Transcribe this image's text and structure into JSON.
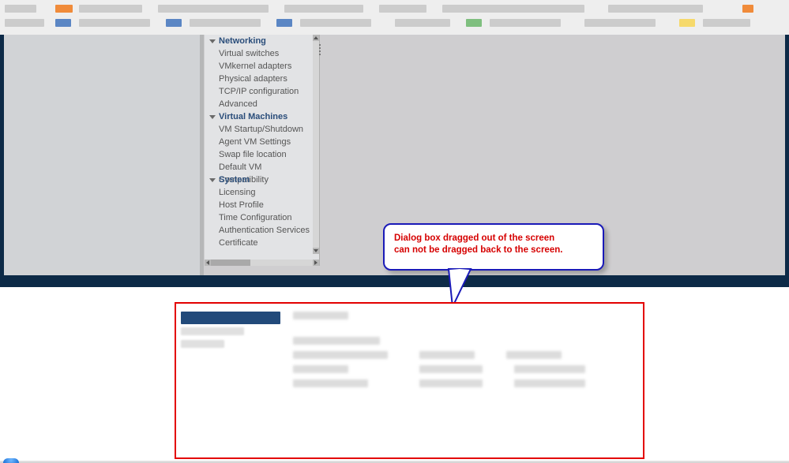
{
  "tree": {
    "groups": [
      {
        "label": "Networking",
        "items": [
          "Virtual switches",
          "VMkernel adapters",
          "Physical adapters",
          "TCP/IP configuration",
          "Advanced"
        ]
      },
      {
        "label": "Virtual Machines",
        "items": [
          "VM Startup/Shutdown",
          "Agent VM Settings",
          "Swap file location",
          "Default VM Compatibility"
        ]
      },
      {
        "label": "System",
        "items": [
          "Licensing",
          "Host Profile",
          "Time Configuration",
          "Authentication Services",
          "Certificate"
        ]
      }
    ]
  },
  "callout": {
    "line1": "Dialog box dragged out of the screen",
    "line2": "can not be dragged back to the screen."
  }
}
